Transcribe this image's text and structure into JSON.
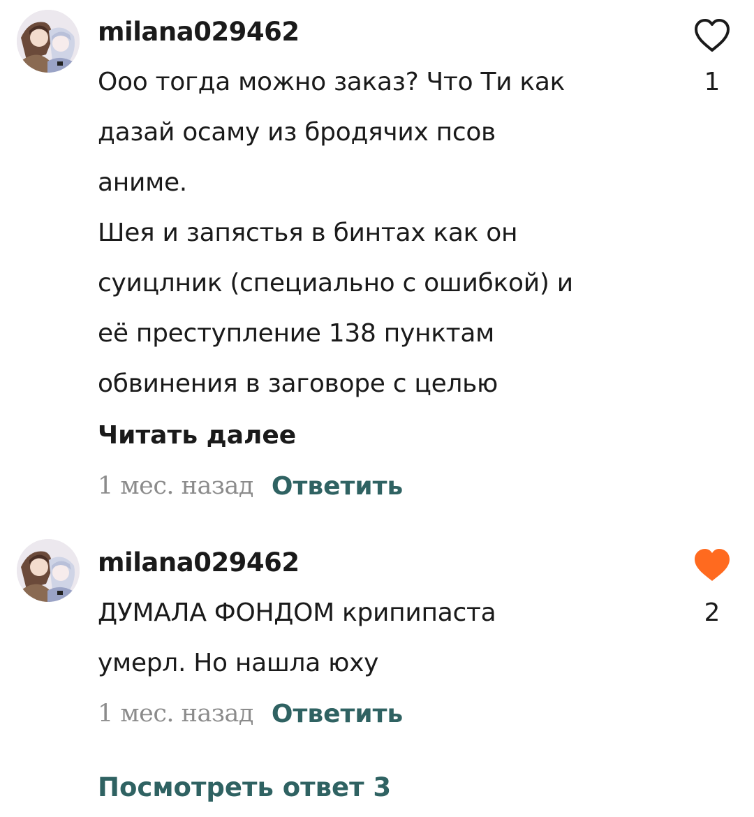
{
  "comments": [
    {
      "username": "milana029462",
      "lines": [
        "Ооо тогда можно заказ? Что Ти как",
        "дазай осаму из бродячих псов",
        "аниме.",
        "Шея и запястья в бинтах как он",
        "суицлник (специально с ошибкой) и",
        "её преступление 138 пунктам",
        "обвинения в заговоре с целью"
      ],
      "read_more": "Читать далее",
      "time": "1 мес. назад",
      "reply": "Ответить",
      "likes": "1",
      "liked": false
    },
    {
      "username": "milana029462",
      "lines": [
        "ДУМАЛА ФОНДОМ крипипаста",
        "умерл. Но нашла юху"
      ],
      "time": "1 мес. назад",
      "reply": "Ответить",
      "likes": "2",
      "liked": true
    }
  ],
  "view_replies": "Посмотреть ответ 3",
  "colors": {
    "like_active": "#ff6a1f",
    "reply_link": "#2f6262",
    "timestamp": "#8b8b8b"
  },
  "icons": {
    "like_inactive": "heart-outline-icon",
    "like_active": "heart-filled-icon"
  }
}
